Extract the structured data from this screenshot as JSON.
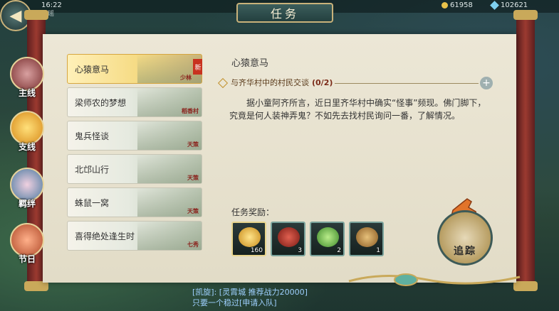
{
  "top_bar": {
    "time": "16:22",
    "sub_label": "碧瑶",
    "currency_1": "61958",
    "currency_2": "102621"
  },
  "title": "任务",
  "categories": [
    {
      "label": "主线"
    },
    {
      "label": "支线"
    },
    {
      "label": "羁绊"
    },
    {
      "label": "节日"
    }
  ],
  "quests": [
    {
      "name": "心猿意马",
      "location": "少林",
      "active": true,
      "tag": "新"
    },
    {
      "name": "梁师农的梦想",
      "location": "稻香村",
      "active": false,
      "tag": ""
    },
    {
      "name": "鬼兵怪谈",
      "location": "天策",
      "active": false,
      "tag": ""
    },
    {
      "name": "北邙山行",
      "location": "天策",
      "active": false,
      "tag": ""
    },
    {
      "name": "蛛鼠一窝",
      "location": "天策",
      "active": false,
      "tag": ""
    },
    {
      "name": "喜得绝处逢生时",
      "location": "七秀",
      "active": false,
      "tag": ""
    }
  ],
  "detail": {
    "title": "心猿意马",
    "objective": "与齐华村中的村民交谈",
    "progress": "(0/2)",
    "description": "据小童阿齐所言，近日里齐华村中确实“怪事”频现。佛门脚下，究竟是何人装神弄鬼？不如先去找村民询问一番，了解情况。",
    "rewards_label": "任务奖励：",
    "rewards": [
      {
        "icon": "gold-ingot-icon",
        "count": "160",
        "color": "#e8b830"
      },
      {
        "icon": "red-fruit-icon",
        "count": "3",
        "color": "#b3302a"
      },
      {
        "icon": "green-vegetable-icon",
        "count": "2",
        "color": "#6fbf4a"
      },
      {
        "icon": "monkey-figure-icon",
        "count": "1",
        "color": "#b9873e"
      }
    ],
    "track_label": "追踪"
  },
  "chat": {
    "line1": "[凯旋]: [灵霄城 推荐战力20000]",
    "line2": "只要一个稳过[申请入队]"
  }
}
